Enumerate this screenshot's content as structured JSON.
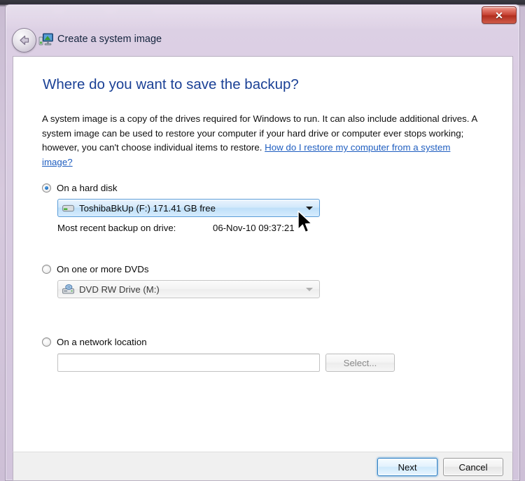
{
  "window": {
    "titlebar": {
      "close_label": "✕",
      "close_icon": "close-icon"
    },
    "back_icon": "back-arrow-icon",
    "header_icon": "system-image-icon",
    "title": "Create a system image"
  },
  "content": {
    "heading": "Where do you want to save the backup?",
    "paragraph_part1": "A system image is a copy of the drives required for Windows to run. It can also include additional drives. A system image can be used to restore your computer if your hard drive or computer ever stops working; however, you can't choose individual items to restore. ",
    "link_text": "How do I restore my computer from a system image?"
  },
  "options": {
    "hard_disk": {
      "label": "On a hard disk",
      "selected": true,
      "drive_icon": "hard-drive-icon",
      "drive_value": "ToshibaBkUp (F:)  171.41 GB free",
      "recent_backup_label": "Most recent backup on drive:",
      "recent_backup_value": "06-Nov-10 09:37:21"
    },
    "dvds": {
      "label": "On one or more DVDs",
      "selected": false,
      "drive_icon": "optical-drive-icon",
      "drive_value": "DVD RW Drive (M:)"
    },
    "network": {
      "label": "On a network location",
      "selected": false,
      "path_value": "",
      "path_placeholder": "",
      "select_label": "Select..."
    }
  },
  "footer": {
    "next_label": "Next",
    "cancel_label": "Cancel"
  },
  "colors": {
    "heading_blue": "#1b4196",
    "link_blue": "#1f5ec0",
    "frame_lavender": "#d7cae0",
    "close_red": "#c33c2c",
    "default_button_border": "#2c7fc4"
  }
}
